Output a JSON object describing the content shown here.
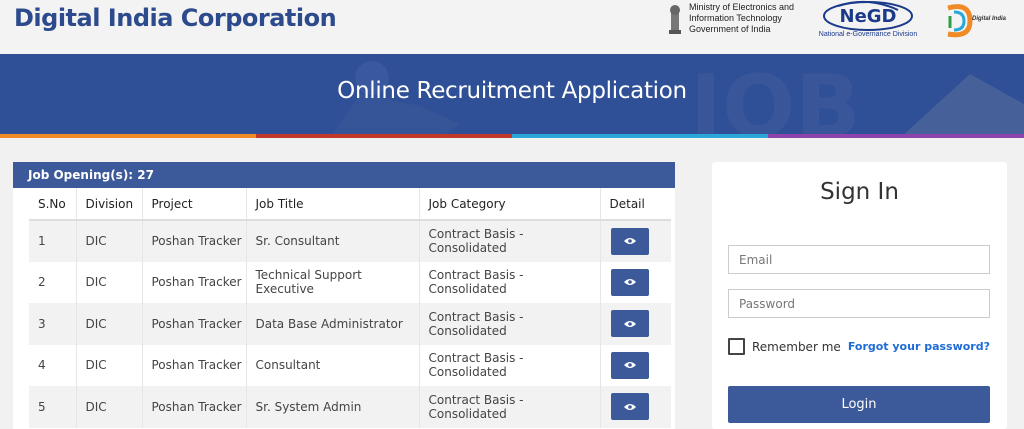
{
  "brand": {
    "title": "Digital India Corporation"
  },
  "logos": {
    "meity_line1": "Ministry of Electronics and",
    "meity_line2": "Information Technology",
    "meity_line3": "Government of India",
    "negd_text": "NeGD",
    "negd_sub": "National e-Governance Division",
    "di_text": "Digital India"
  },
  "banner": {
    "title": "Online Recruitment Application"
  },
  "stripe_colors": [
    "#f08a24",
    "#c0392b",
    "#2aa7d8",
    "#8e44ad"
  ],
  "jobs": {
    "header_label": "Job Opening(s): 27",
    "columns": [
      "S.No",
      "Division",
      "Project",
      "Job Title",
      "Job Category",
      "Detail"
    ],
    "rows": [
      {
        "sno": "1",
        "division": "DIC",
        "project": "Poshan Tracker",
        "title": "Sr. Consultant",
        "category": "Contract Basis - Consolidated"
      },
      {
        "sno": "2",
        "division": "DIC",
        "project": "Poshan Tracker",
        "title": "Technical Support Executive",
        "category": "Contract Basis - Consolidated"
      },
      {
        "sno": "3",
        "division": "DIC",
        "project": "Poshan Tracker",
        "title": "Data Base Administrator",
        "category": "Contract Basis - Consolidated"
      },
      {
        "sno": "4",
        "division": "DIC",
        "project": "Poshan Tracker",
        "title": "Consultant",
        "category": "Contract Basis - Consolidated"
      },
      {
        "sno": "5",
        "division": "DIC",
        "project": "Poshan Tracker",
        "title": "Sr. System Admin",
        "category": "Contract Basis - Consolidated"
      }
    ],
    "detail_icon": "eye-icon"
  },
  "signin": {
    "title": "Sign In",
    "email_placeholder": "Email",
    "password_placeholder": "Password",
    "remember_label": "Remember me",
    "forgot_label": "Forgot your password?",
    "login_label": "Login"
  }
}
